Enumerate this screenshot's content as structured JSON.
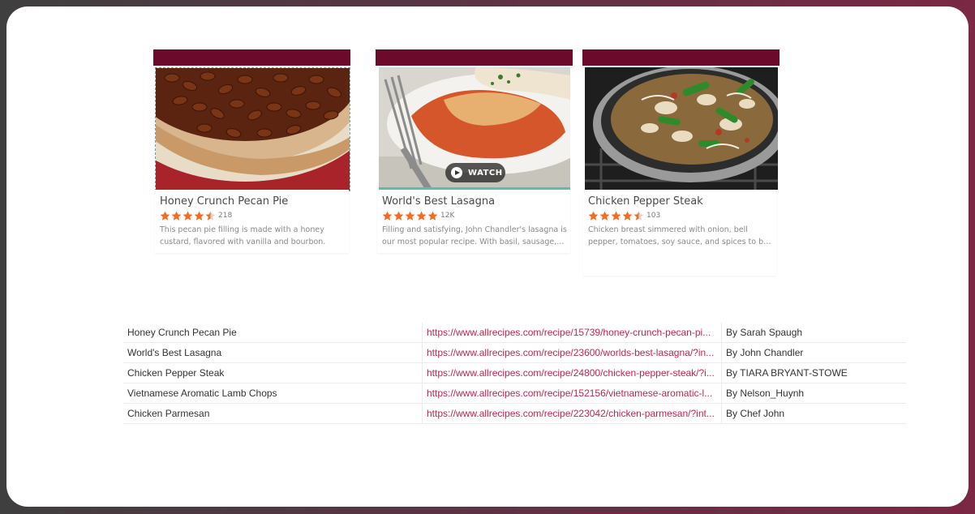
{
  "colors": {
    "card_bar": "#6b0a2a",
    "star": "#f26c22",
    "link": "#c0264e"
  },
  "cards": [
    {
      "title": "Honey Crunch Pecan Pie",
      "rating": 4.5,
      "rating_count": "218",
      "desc_lines": [
        "This pecan pie filling is made with a honey",
        "custard, flavored with vanilla and bourbon."
      ],
      "image_icon": "pecan-pie-photo"
    },
    {
      "title": "World's Best Lasagna",
      "rating": 5,
      "rating_count": "12K",
      "desc_lines": [
        "Filling and satisfying, John Chandler's lasagna is",
        "our most popular recipe. With basil, sausage,..."
      ],
      "image_icon": "lasagna-photo",
      "watch_label": "WATCH"
    },
    {
      "title": "Chicken Pepper Steak",
      "rating": 4.5,
      "rating_count": "103",
      "desc_lines": [
        "Chicken breast simmered with onion, bell",
        "pepper, tomatoes, soy sauce, and spices to be..."
      ],
      "image_icon": "chicken-pepper-steak-photo"
    }
  ],
  "table": {
    "rows": [
      {
        "name": "Honey Crunch Pecan Pie",
        "url": "https://www.allrecipes.com/recipe/15739/honey-crunch-pecan-pi...",
        "author": "By Sarah Spaugh"
      },
      {
        "name": "World's Best Lasagna",
        "url": "https://www.allrecipes.com/recipe/23600/worlds-best-lasagna/?in...",
        "author": "By John Chandler"
      },
      {
        "name": "Chicken Pepper Steak",
        "url": "https://www.allrecipes.com/recipe/24800/chicken-pepper-steak/?i...",
        "author": "By TIARA BRYANT-STOWE"
      },
      {
        "name": "Vietnamese Aromatic Lamb Chops",
        "url": "https://www.allrecipes.com/recipe/152156/vietnamese-aromatic-l...",
        "author": "By Nelson_Huynh"
      },
      {
        "name": "Chicken Parmesan",
        "url": "https://www.allrecipes.com/recipe/223042/chicken-parmesan/?int...",
        "author": "By Chef John"
      }
    ]
  }
}
